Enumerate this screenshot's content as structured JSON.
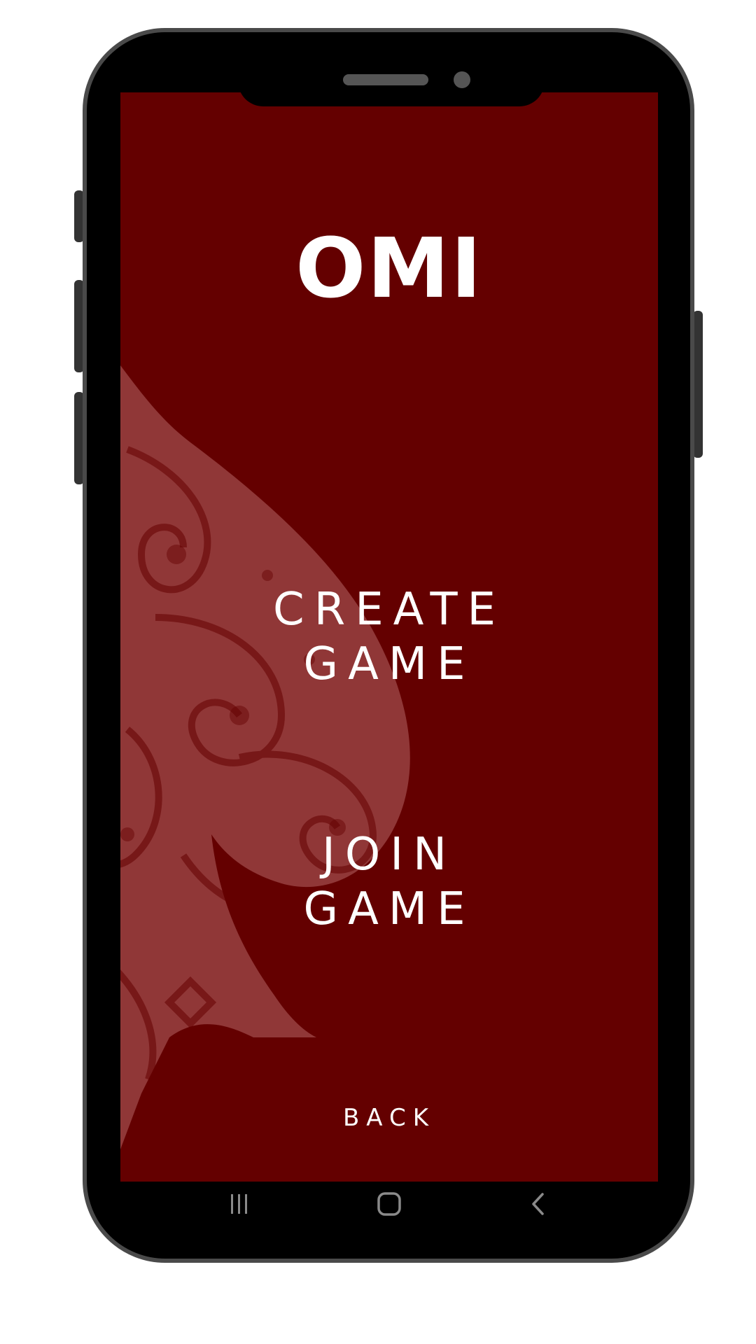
{
  "app": {
    "logo_text": "OMI",
    "create_game": {
      "line1": "CREATE",
      "line2": "GAME"
    },
    "join_game": {
      "line1": "JOIN",
      "line2": "GAME"
    },
    "back_label": "BACK"
  },
  "navbar": {
    "items": [
      {
        "icon": "recent-apps-icon"
      },
      {
        "icon": "home-icon"
      },
      {
        "icon": "back-arrow-icon"
      }
    ]
  },
  "colors": {
    "background": "#640000",
    "text": "#ffffff",
    "ornament": "#b46464",
    "phone_frame": "#000000",
    "phone_border": "#4a4a4a"
  }
}
